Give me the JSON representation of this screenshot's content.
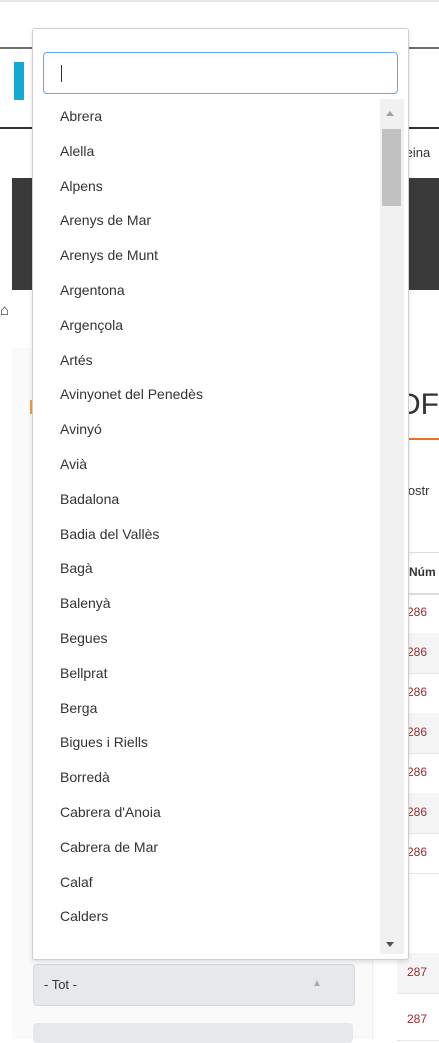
{
  "background": {
    "feina_text": "feina",
    "heading_fragment": "DF",
    "mostr_text": "Mostr",
    "table_header": "Núm",
    "rows": [
      "286",
      "286",
      "286",
      "286",
      "286",
      "286",
      "286",
      "287",
      "287"
    ],
    "home_icon": "home-icon",
    "select_label": "- Tot -"
  },
  "dropdown": {
    "search_value": "",
    "options": [
      "Abrera",
      "Alella",
      "Alpens",
      "Arenys de Mar",
      "Arenys de Munt",
      "Argentona",
      "Argençola",
      "Artés",
      "Avinyonet del Penedès",
      "Avinyó",
      "Avià",
      "Badalona",
      "Badia del Vallès",
      "Bagà",
      "Balenyà",
      "Begues",
      "Bellprat",
      "Berga",
      "Bigues i Riells",
      "Borredà",
      "Cabrera d'Anoia",
      "Cabrera de Mar",
      "Calaf",
      "Calders"
    ]
  },
  "colors": {
    "accent_blue": "#62a8e8",
    "logo_cyan": "#14aad0",
    "link_red": "#9a2b2b",
    "orange": "#f07020"
  }
}
